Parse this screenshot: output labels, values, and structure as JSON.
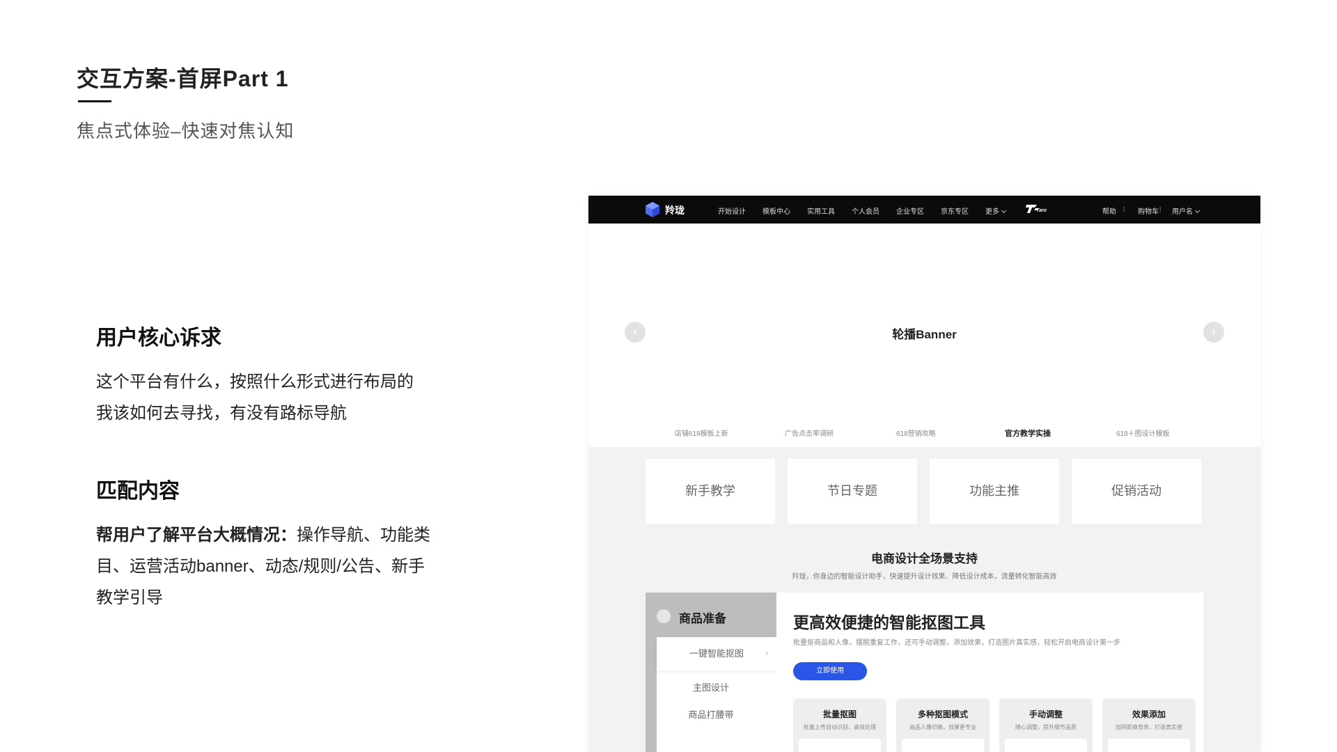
{
  "slide": {
    "title": "交互方案-首屏Part 1",
    "subtitle": "焦点式体验–快速对焦认知",
    "section1": {
      "heading": "用户核心诉求",
      "line1": "这个平台有什么，按照什么形式进行布局的",
      "line2": "我该如何去寻找，有没有路标导航"
    },
    "section2": {
      "heading": "匹配内容",
      "bold": "帮用户了解平台大概情况：",
      "line1": "操作导航、功能类",
      "line2": "目、运营活动banner、动态/规则/公告、新手",
      "line3": "教学引导"
    }
  },
  "mock": {
    "brand": "羚珑",
    "nav": [
      "开始设计",
      "模板中心",
      "实用工具",
      "个人会员",
      "企业专区",
      "京东专区",
      "更多"
    ],
    "taro": "Taro",
    "right_nav": {
      "help": "帮助",
      "cart": "购物车",
      "user": "用户名",
      "separator": "|"
    },
    "banner": {
      "title": "轮播Banner",
      "prev": "‹",
      "next": "›",
      "tabs": [
        "店铺618模板上新",
        "广告点击率调研",
        "618营销攻略",
        "官方教学实操",
        "618＋图设计模板"
      ]
    },
    "quick_entries": [
      "新手教学",
      "节日专题",
      "功能主推",
      "促销活动"
    ],
    "scene": {
      "title": "电商设计全场景支持",
      "subtitle": "羚珑，你身边的智能设计助手，快速提升设计效果、降低设计成本，流量转化智能高效"
    },
    "left_panel": {
      "heading": "商品准备",
      "items": [
        "一键智能抠图",
        "主图设计",
        "商品打腰带"
      ],
      "arrow": "›"
    },
    "right_panel": {
      "title": "更高效便捷的智能抠图工具",
      "desc": "批量抠商品和人像，摆脱重复工作，还可手动调整，添加效果，打造图片真实感，轻松开启电商设计第一步",
      "button": "立即使用",
      "cards": [
        {
          "title": "批量抠图",
          "desc": "批量上传自动识别，高效处理"
        },
        {
          "title": "多种抠图模式",
          "desc": "商品人像切换，效果更专业"
        },
        {
          "title": "手动调整",
          "desc": "随心调整，提升细节品质"
        },
        {
          "title": "效果添加",
          "desc": "加阴影换背景，打造真实感"
        }
      ]
    },
    "colors": {
      "accent": "#2a56e8",
      "nav_bg": "#0b0b0b"
    }
  }
}
